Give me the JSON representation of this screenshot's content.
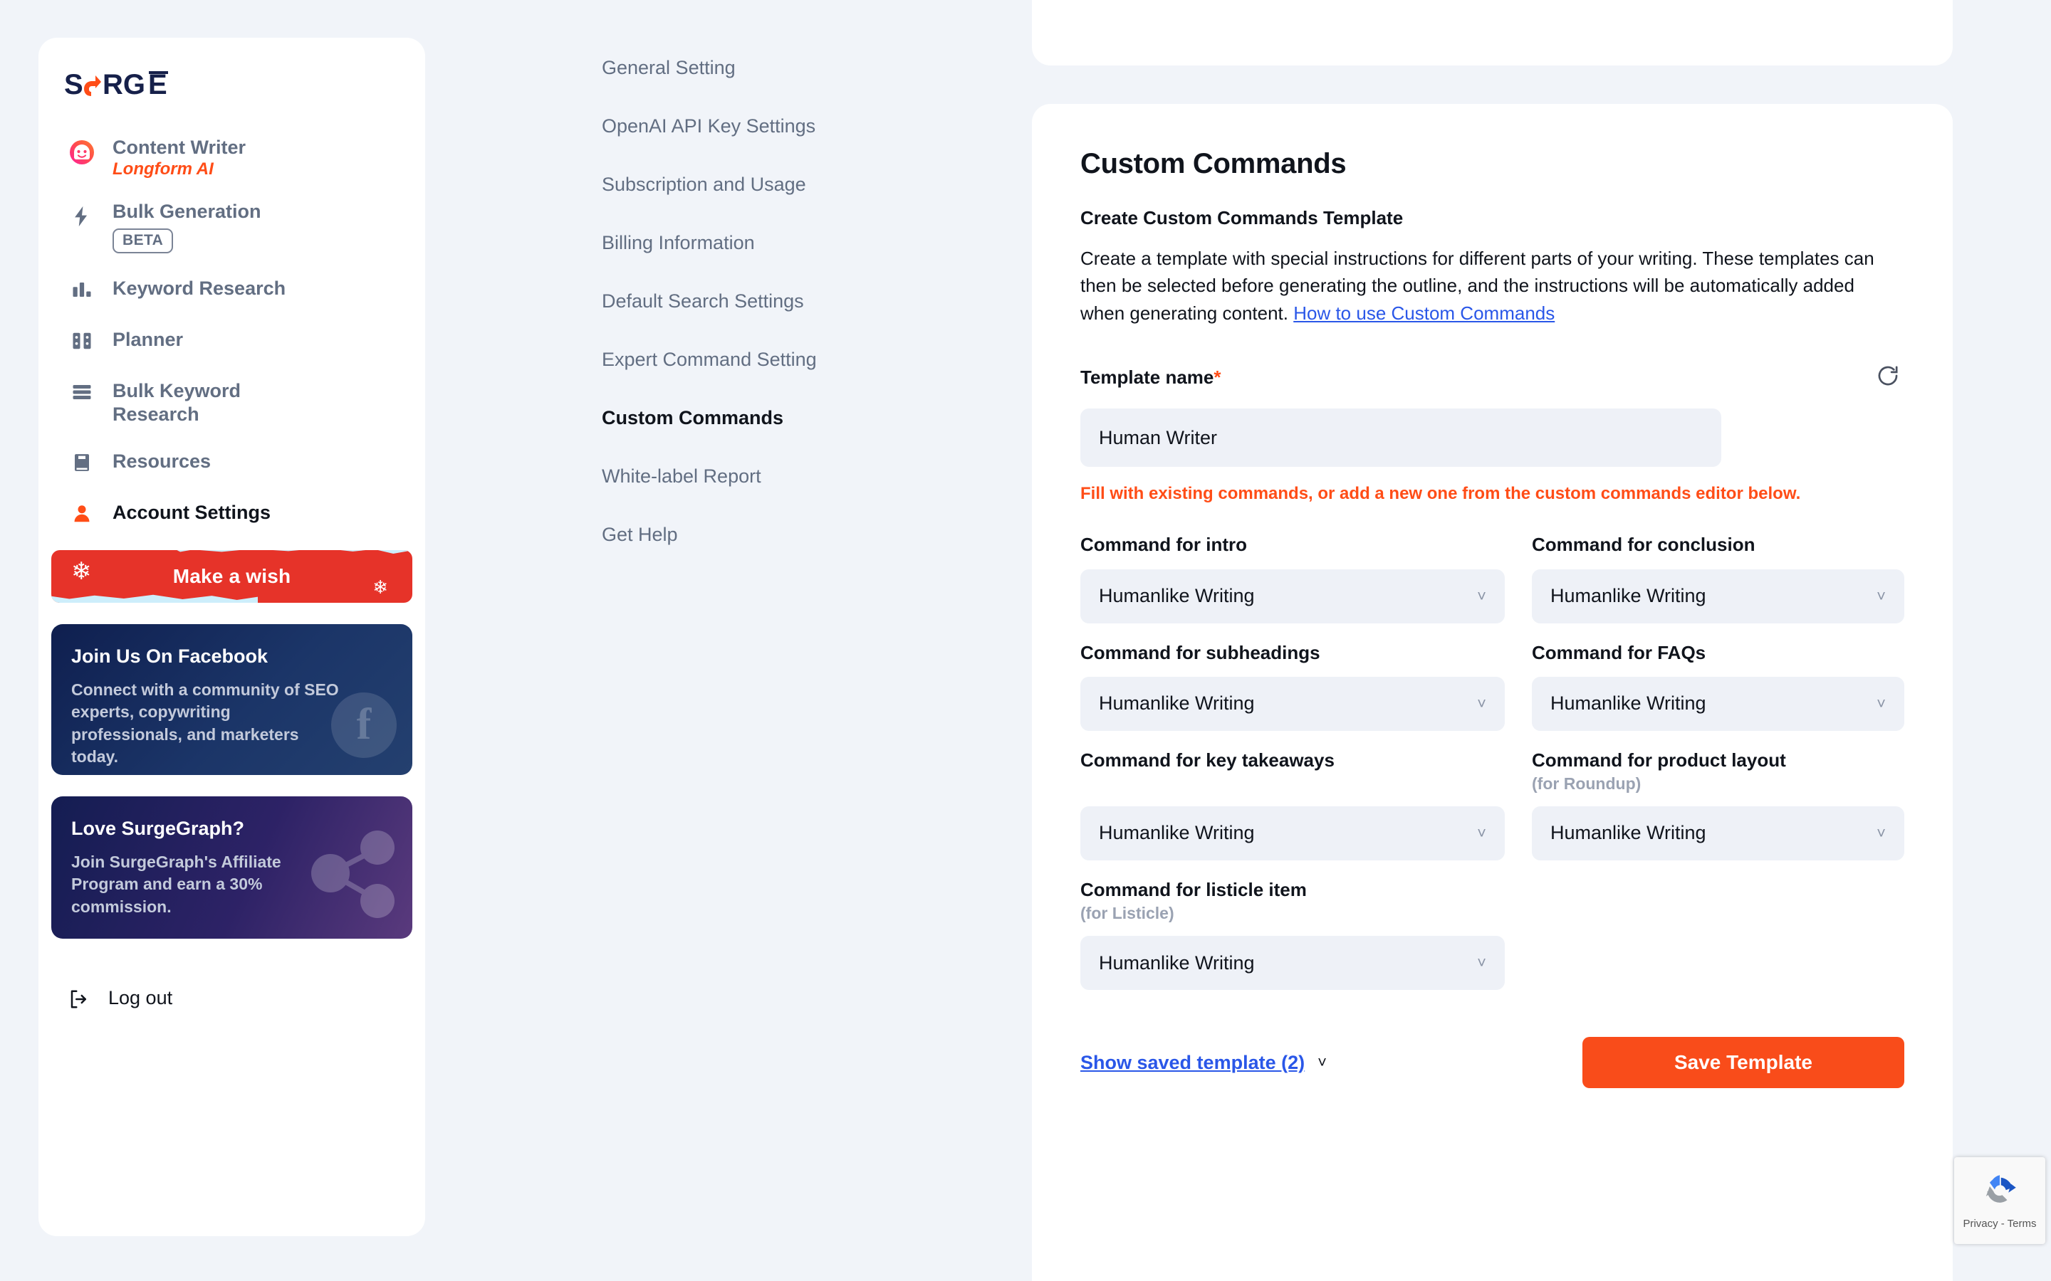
{
  "brand": {
    "logo_text": "SURGE",
    "accent": "#ff4d17",
    "navy": "#16204a"
  },
  "sidebar": {
    "items": [
      {
        "label": "Content Writer",
        "sub": "Longform AI",
        "icon": "face-avatar-icon",
        "active": false
      },
      {
        "label": "Bulk Generation",
        "badge": "BETA",
        "icon": "lightning-icon",
        "active": false
      },
      {
        "label": "Keyword Research",
        "icon": "bar-chart-icon",
        "active": false
      },
      {
        "label": "Planner",
        "icon": "planner-icon",
        "active": false
      },
      {
        "label": "Bulk Keyword Research",
        "icon": "stacked-rows-icon",
        "active": false
      },
      {
        "label": "Resources",
        "icon": "book-icon",
        "active": false
      },
      {
        "label": "Account Settings",
        "icon": "person-icon",
        "active": true
      }
    ],
    "wish_button": {
      "label": "Make a wish",
      "icon": "snowflake-icon",
      "color": "#e63329"
    },
    "promos": [
      {
        "title": "Join Us On Facebook",
        "body": "Connect with a community of SEO experts, copywriting professionals, and marketers today.",
        "icon": "facebook-icon"
      },
      {
        "title": "Love SurgeGraph?",
        "body": "Join SurgeGraph's Affiliate Program and earn a 30% commission.",
        "icon": "affiliate-network-icon"
      }
    ],
    "logout": {
      "label": "Log out",
      "icon": "logout-icon"
    }
  },
  "settings_menu": {
    "items": [
      {
        "label": "General Setting",
        "active": false
      },
      {
        "label": "OpenAI API Key Settings",
        "active": false
      },
      {
        "label": "Subscription and Usage",
        "active": false
      },
      {
        "label": "Billing Information",
        "active": false
      },
      {
        "label": "Default Search Settings",
        "active": false
      },
      {
        "label": "Expert Command Setting",
        "active": false
      },
      {
        "label": "Custom Commands",
        "active": true
      },
      {
        "label": "White-label Report",
        "active": false
      },
      {
        "label": "Get Help",
        "active": false
      }
    ]
  },
  "main": {
    "title": "Custom Commands",
    "section_title": "Create Custom Commands Template",
    "description": "Create a template with special instructions for different parts of your writing. These templates can then be selected before generating the outline, and the instructions will be automatically added when generating content. ",
    "description_link": "How to use Custom Commands",
    "template_name_label": "Template name",
    "required_mark": "*",
    "template_name_value": "Human Writer",
    "template_name_placeholder": "Template name",
    "refresh_icon": "refresh-icon",
    "hint": "Fill with existing commands, or add a new one from the custom commands editor below.",
    "fields": [
      {
        "label": "Command for intro",
        "note": "",
        "value": "Humanlike Writing",
        "column": "left"
      },
      {
        "label": "Command for conclusion",
        "note": "",
        "value": "Humanlike Writing",
        "column": "right"
      },
      {
        "label": "Command for subheadings",
        "note": "",
        "value": "Humanlike Writing",
        "column": "left"
      },
      {
        "label": "Command for FAQs",
        "note": "",
        "value": "Humanlike Writing",
        "column": "right"
      },
      {
        "label": "Command for key takeaways",
        "note": "",
        "value": "Humanlike Writing",
        "column": "left"
      },
      {
        "label": "Command for product layout",
        "note": "(for Roundup)",
        "value": "Humanlike Writing",
        "column": "right"
      },
      {
        "label": "Command for listicle item",
        "note": "(for Listicle)",
        "value": "Humanlike Writing",
        "column": "left"
      }
    ],
    "show_saved_label": "Show saved template (2)",
    "save_button": "Save Template"
  },
  "recaptcha": {
    "privacy": "Privacy - Terms",
    "icon": "recaptcha-icon"
  }
}
